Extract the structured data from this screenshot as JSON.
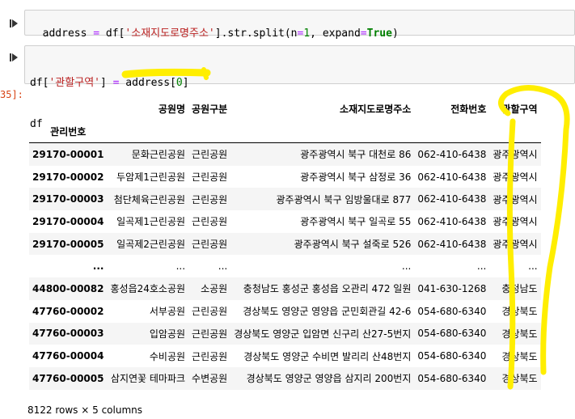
{
  "cell1": {
    "run_icon": "run-icon",
    "code_parts": [
      "address ",
      "=",
      " df[",
      "'소재지도로명주소'",
      "].str.split(n",
      "=",
      "1",
      ", expand",
      "=",
      "True",
      ")"
    ]
  },
  "cell2": {
    "run_icon": "run-icon",
    "line1_parts": [
      "df[",
      "'관할구역'",
      "] ",
      "=",
      " address[",
      "0",
      "]"
    ],
    "line2": "df"
  },
  "output_prompt": "35]:",
  "table": {
    "columns": [
      "공원명",
      "공원구분",
      "소재지도로명주소",
      "전화번호",
      "관할구역"
    ],
    "index_name": "관리번호",
    "rows": [
      {
        "idx": "29170-00001",
        "cells": [
          "문화근린공원",
          "근린공원",
          "광주광역시 북구 대천로 86",
          "062-410-6438",
          "광주광역시"
        ]
      },
      {
        "idx": "29170-00002",
        "cells": [
          "두암제1근린공원",
          "근린공원",
          "광주광역시 북구 삼정로 36",
          "062-410-6438",
          "광주광역시"
        ]
      },
      {
        "idx": "29170-00003",
        "cells": [
          "첨단체육근린공원",
          "근린공원",
          "광주광역시 북구 임방울대로 877",
          "062-410-6438",
          "광주광역시"
        ]
      },
      {
        "idx": "29170-00004",
        "cells": [
          "일곡제1근린공원",
          "근린공원",
          "광주광역시 북구 일곡로 55",
          "062-410-6438",
          "광주광역시"
        ]
      },
      {
        "idx": "29170-00005",
        "cells": [
          "일곡제2근린공원",
          "근린공원",
          "광주광역시 북구 설죽로 526",
          "062-410-6438",
          "광주광역시"
        ]
      },
      {
        "idx": "...",
        "cells": [
          "...",
          "...",
          "...",
          "...",
          "..."
        ]
      },
      {
        "idx": "44800-00082",
        "cells": [
          "홍성읍24호소공원",
          "소공원",
          "충청남도 홍성군 홍성읍 오관리 472 일원",
          "041-630-1268",
          "충청남도"
        ]
      },
      {
        "idx": "47760-00002",
        "cells": [
          "서부공원",
          "근린공원",
          "경상북도 영양군 영양읍 군민회관길 42-6",
          "054-680-6340",
          "경상북도"
        ]
      },
      {
        "idx": "47760-00003",
        "cells": [
          "입암공원",
          "근린공원",
          "경상북도 영양군 입암면 신구리 산27-5번지",
          "054-680-6340",
          "경상북도"
        ]
      },
      {
        "idx": "47760-00004",
        "cells": [
          "수비공원",
          "근린공원",
          "경상북도 영양군 수비면 발리리 산48번지",
          "054-680-6340",
          "경상북도"
        ]
      },
      {
        "idx": "47760-00005",
        "cells": [
          "삼지연꽃 테마파크",
          "수변공원",
          "경상북도 영양군 영양읍 삼지리 200번지",
          "054-680-6340",
          "경상북도"
        ]
      }
    ]
  },
  "footer": "8122 rows × 5 columns",
  "highlight_color": "#ffee00"
}
